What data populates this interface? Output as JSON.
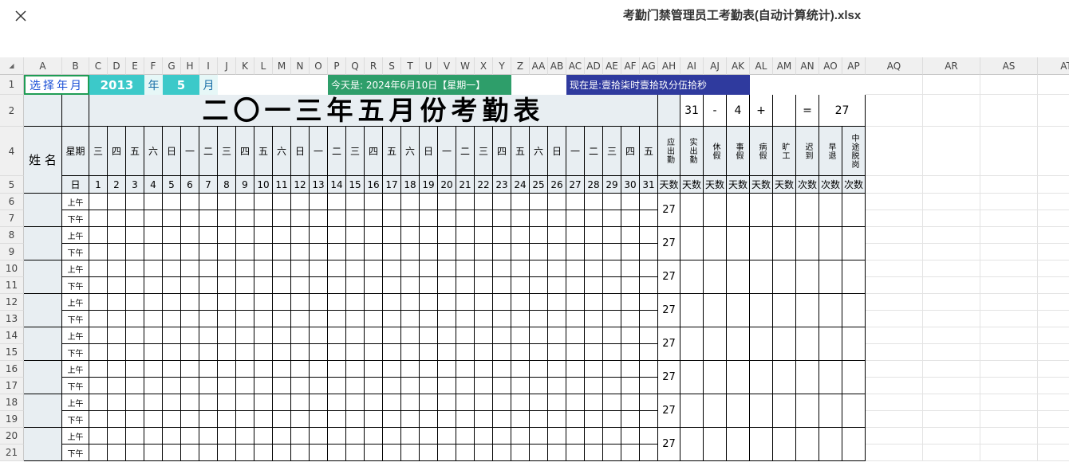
{
  "file": {
    "name": "考勤门禁管理员工考勤表(自动计算统计).xlsx"
  },
  "columns": [
    "A",
    "B",
    "C",
    "D",
    "E",
    "F",
    "G",
    "H",
    "I",
    "J",
    "K",
    "L",
    "M",
    "N",
    "O",
    "P",
    "Q",
    "R",
    "S",
    "T",
    "U",
    "V",
    "W",
    "X",
    "Y",
    "Z",
    "AA",
    "AB",
    "AC",
    "AD",
    "AE",
    "AF",
    "AG",
    "AH",
    "AI",
    "AJ",
    "AK",
    "AL",
    "AM",
    "AN",
    "AO",
    "AP",
    "AQ",
    "AR",
    "AS",
    "AT"
  ],
  "rows": [
    "1",
    "2",
    "4",
    "5",
    "6",
    "7",
    "8",
    "9",
    "10",
    "11",
    "12",
    "13",
    "14",
    "15",
    "16",
    "17",
    "18",
    "19",
    "20",
    "21"
  ],
  "selector": {
    "label": "选择年月",
    "year": "2013",
    "year_unit": "年",
    "month": "5",
    "month_unit": "月"
  },
  "today": "今天是: 2024年6月10日【星期一】",
  "now": "现在是:壹拾柒时壹拾玖分伍拾秒",
  "title": "二〇一三年五月份考勤表",
  "summary": {
    "days": "31",
    "minus": "-",
    "subtract": "4",
    "plus": "+",
    "equals": "=",
    "result": "27"
  },
  "header": {
    "name": "姓 名",
    "weekday_label": "星期",
    "day_label": "日"
  },
  "weekdays": [
    "三",
    "四",
    "五",
    "六",
    "日",
    "一",
    "二",
    "三",
    "四",
    "五",
    "六",
    "日",
    "一",
    "二",
    "三",
    "四",
    "五",
    "六",
    "日",
    "一",
    "二",
    "三",
    "四",
    "五",
    "六",
    "日",
    "一",
    "二",
    "三",
    "四",
    "五"
  ],
  "days": [
    "1",
    "2",
    "3",
    "4",
    "5",
    "6",
    "7",
    "8",
    "9",
    "10",
    "11",
    "12",
    "13",
    "14",
    "15",
    "16",
    "17",
    "18",
    "19",
    "20",
    "21",
    "22",
    "23",
    "24",
    "25",
    "26",
    "27",
    "28",
    "29",
    "30",
    "31"
  ],
  "stats": [
    {
      "label": "应出勤",
      "unit": "天数"
    },
    {
      "label": "实出勤",
      "unit": "天数"
    },
    {
      "label": "休假",
      "unit": "天数"
    },
    {
      "label": "事假",
      "unit": "天数"
    },
    {
      "label": "病假",
      "unit": "天数"
    },
    {
      "label": "旷工",
      "unit": "天数"
    },
    {
      "label": "迟到",
      "unit": "次数"
    },
    {
      "label": "早退",
      "unit": "次数"
    },
    {
      "label": "中途脱岗",
      "unit": "次数"
    }
  ],
  "shifts": {
    "am": "上午",
    "pm": "下午"
  },
  "employee_groups": [
    {
      "attendance": "27"
    },
    {
      "attendance": "27"
    },
    {
      "attendance": "27"
    },
    {
      "attendance": "27"
    },
    {
      "attendance": "27"
    },
    {
      "attendance": "27"
    },
    {
      "attendance": "27"
    },
    {
      "attendance": "27"
    }
  ],
  "colors": {
    "selector_border": "#1f9d55",
    "selector_text": "#1a4fd6",
    "year_fill": "#3cc9c9",
    "month_fill": "#3cc9c9",
    "unit_fill": "#e6f7f7",
    "today_fill": "#2e9e6a",
    "now_fill": "#2f3a9e",
    "header_fill": "#e8eef2"
  }
}
